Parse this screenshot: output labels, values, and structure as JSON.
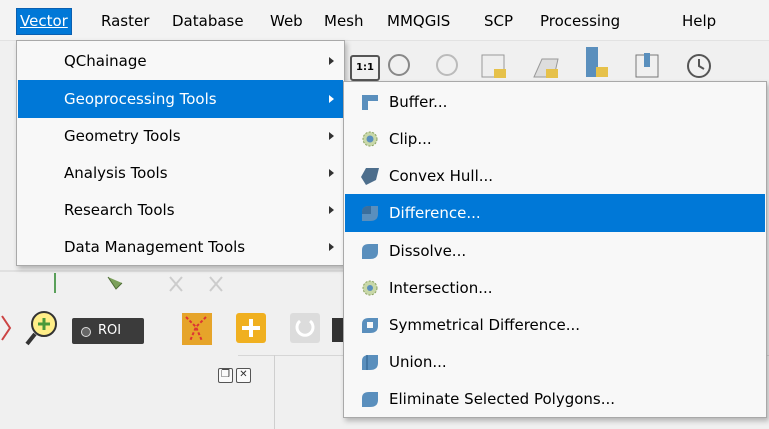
{
  "menubar": {
    "items": [
      {
        "label": "Vector",
        "active": true
      },
      {
        "label": "Raster",
        "active": false
      },
      {
        "label": "Database",
        "active": false
      },
      {
        "label": "Web",
        "active": false
      },
      {
        "label": "Mesh",
        "active": false
      },
      {
        "label": "MMQGIS",
        "active": false
      },
      {
        "label": "SCP",
        "active": false
      },
      {
        "label": "Processing",
        "active": false
      },
      {
        "label": "Help",
        "active": false
      }
    ]
  },
  "vector_menu": {
    "items": [
      {
        "label": "QChainage",
        "highlighted": false
      },
      {
        "label": "Geoprocessing Tools",
        "highlighted": true
      },
      {
        "label": "Geometry Tools",
        "highlighted": false
      },
      {
        "label": "Analysis Tools",
        "highlighted": false
      },
      {
        "label": "Research Tools",
        "highlighted": false
      },
      {
        "label": "Data Management Tools",
        "highlighted": false
      }
    ]
  },
  "geoprocessing_menu": {
    "items": [
      {
        "label": "Buffer...",
        "icon": "buffer-icon",
        "highlighted": false
      },
      {
        "label": "Clip...",
        "icon": "clip-icon",
        "highlighted": false
      },
      {
        "label": "Convex Hull...",
        "icon": "convex-hull-icon",
        "highlighted": false
      },
      {
        "label": "Difference...",
        "icon": "difference-icon",
        "highlighted": true
      },
      {
        "label": "Dissolve...",
        "icon": "dissolve-icon",
        "highlighted": false
      },
      {
        "label": "Intersection...",
        "icon": "intersection-icon",
        "highlighted": false
      },
      {
        "label": "Symmetrical Difference...",
        "icon": "symmetrical-difference-icon",
        "highlighted": false
      },
      {
        "label": "Union...",
        "icon": "union-icon",
        "highlighted": false
      },
      {
        "label": "Eliminate Selected Polygons...",
        "icon": "eliminate-selected-polygons-icon",
        "highlighted": false
      }
    ]
  },
  "toolbar": {
    "roi_label": "ROI",
    "scale_icon_label": "1:1"
  },
  "colors": {
    "highlight": "#0078d7",
    "menu_bg": "#f8f8f8",
    "icon_blue": "#5a8fbd"
  }
}
